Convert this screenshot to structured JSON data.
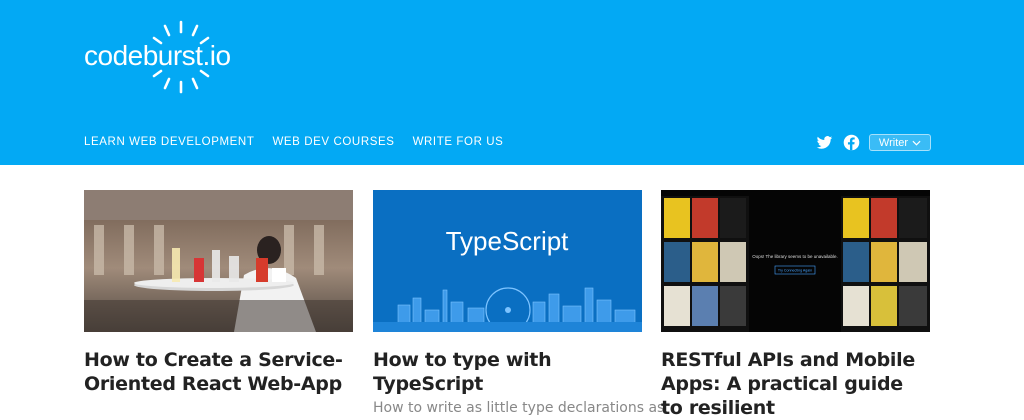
{
  "brand": {
    "logo_text": "codeburst.io"
  },
  "nav": {
    "items": [
      "LEARN WEB DEVELOPMENT",
      "WEB DEV COURSES",
      "WRITE FOR US"
    ]
  },
  "social": {
    "twitter_icon": "twitter-icon",
    "facebook_icon": "facebook-icon"
  },
  "writer_menu": {
    "label": "Writer"
  },
  "cards": [
    {
      "title": "How to Create a Service-Oriented React Web-App",
      "subtitle": "",
      "image": "waiter-tray-photo"
    },
    {
      "title": "How to type with TypeScript",
      "subtitle": "How to write as little type declarations as",
      "image": "typescript-banner",
      "image_text": "TypeScript"
    },
    {
      "title": "RESTful APIs and Mobile Apps: A practical guide to resilient",
      "subtitle": "",
      "image": "movie-posters-app-screenshot",
      "image_text": "Oops! The library seems to be unavailable.",
      "image_button": "Try Connecting Again"
    }
  ],
  "colors": {
    "header_bg": "#03a9f4",
    "title_text": "#222222",
    "subtitle_text": "#888888",
    "typescript_bg": "#0a6fc2"
  }
}
